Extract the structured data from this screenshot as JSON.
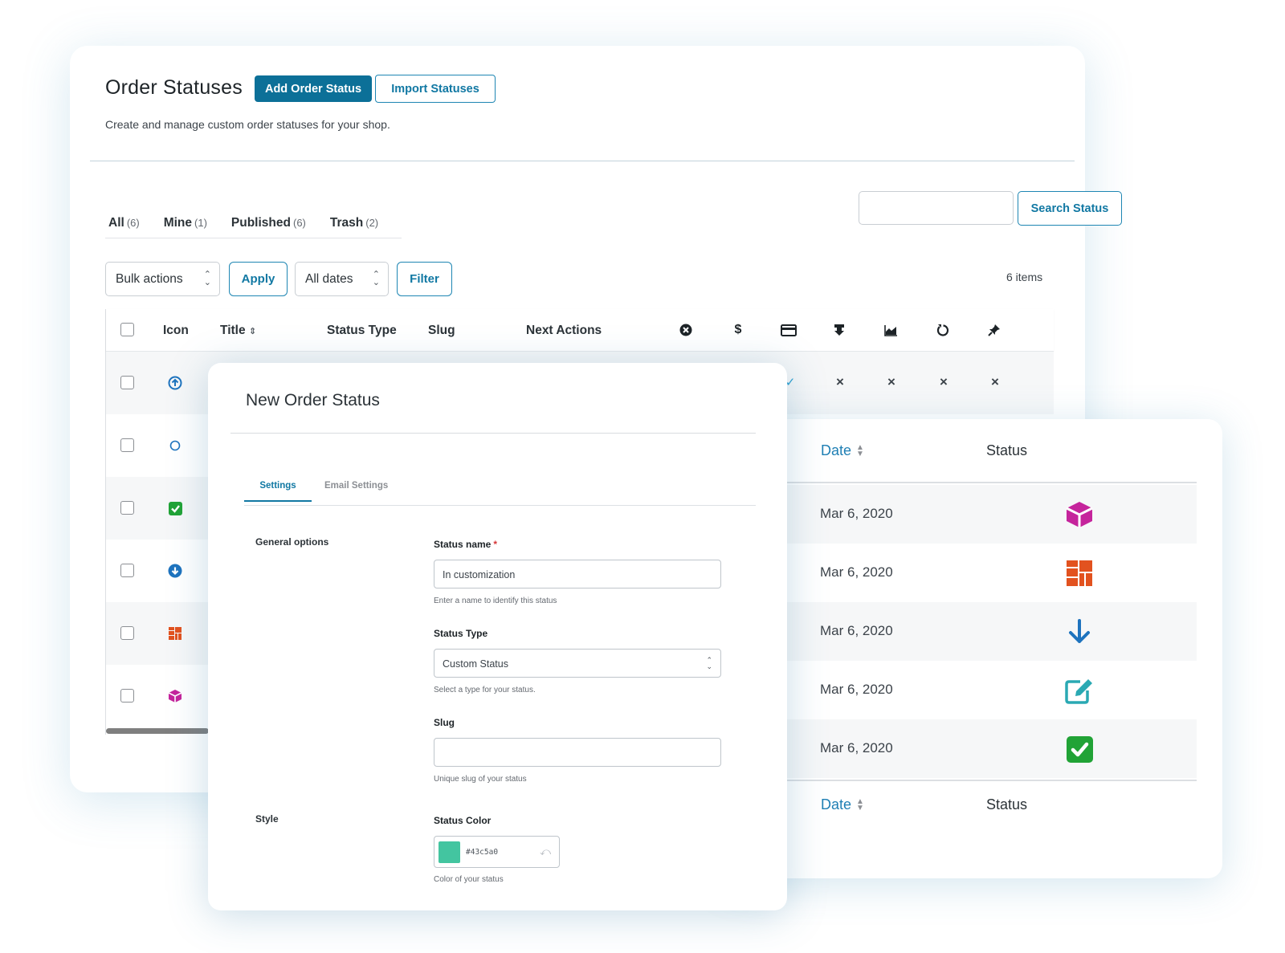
{
  "page": {
    "title": "Order Statuses",
    "add_button": "Add Order Status",
    "import_button": "Import Statuses",
    "subtitle": "Create and manage custom order statuses for your shop."
  },
  "views": [
    {
      "label": "All",
      "count": "(6)"
    },
    {
      "label": "Mine",
      "count": "(1)"
    },
    {
      "label": "Published",
      "count": "(6)"
    },
    {
      "label": "Trash",
      "count": "(2)"
    }
  ],
  "search": {
    "button": "Search Status",
    "value": ""
  },
  "toolbar": {
    "bulk_actions": "Bulk actions",
    "apply": "Apply",
    "dates": "All dates",
    "filter": "Filter",
    "items_count": "6 items"
  },
  "table": {
    "columns": {
      "icon": "Icon",
      "title": "Title",
      "status_type": "Status Type",
      "slug": "Slug",
      "next_actions": "Next Actions"
    },
    "action_icons": [
      "cancel-circle-icon",
      "dollar-icon",
      "credit-card-icon",
      "download-icon",
      "chart-area-icon",
      "refresh-icon",
      "pin-icon"
    ],
    "rows": [
      {
        "icon": "arrow-up-circle-icon",
        "icon_color": "#1e73be",
        "flags": [
          "✓",
          "×",
          "×",
          "×",
          "×"
        ]
      },
      {
        "icon": "circle-outline-icon",
        "icon_color": "#1e73be"
      },
      {
        "icon": "check-square-icon",
        "icon_color": "#21a336"
      },
      {
        "icon": "arrow-down-circle-icon",
        "icon_color": "#1e73be"
      },
      {
        "icon": "blocks-icon",
        "icon_color": "#e2521f"
      },
      {
        "icon": "cube-icon",
        "icon_color": "#c5249c"
      }
    ]
  },
  "modal": {
    "title": "New Order Status",
    "tabs": {
      "settings": "Settings",
      "email": "Email Settings"
    },
    "general_options": "General options",
    "style": "Style",
    "status_name": {
      "label": "Status name",
      "required": "*",
      "value": "In customization",
      "help": "Enter a name to identify this status"
    },
    "status_type": {
      "label": "Status Type",
      "value": "Custom Status",
      "help": "Select a type for your status."
    },
    "slug": {
      "label": "Slug",
      "value": "",
      "help": "Unique slug of your status"
    },
    "status_color": {
      "label": "Status Color",
      "value": "#43c5a0",
      "help": "Color of your status"
    }
  },
  "right_table": {
    "date_header": "Date",
    "status_header": "Status",
    "rows": [
      {
        "date": "Mar 6, 2020",
        "icon": "cube-icon",
        "color": "#c5249c"
      },
      {
        "date": "Mar 6, 2020",
        "icon": "blocks-icon",
        "color": "#e2521f"
      },
      {
        "date": "Mar 6, 2020",
        "icon": "arrow-down-icon",
        "color": "#1e73be"
      },
      {
        "date": "Mar 6, 2020",
        "icon": "edit-icon",
        "color": "#2aa9b3"
      },
      {
        "date": "Mar 6, 2020",
        "icon": "check-square-icon",
        "color": "#21a336"
      }
    ]
  }
}
